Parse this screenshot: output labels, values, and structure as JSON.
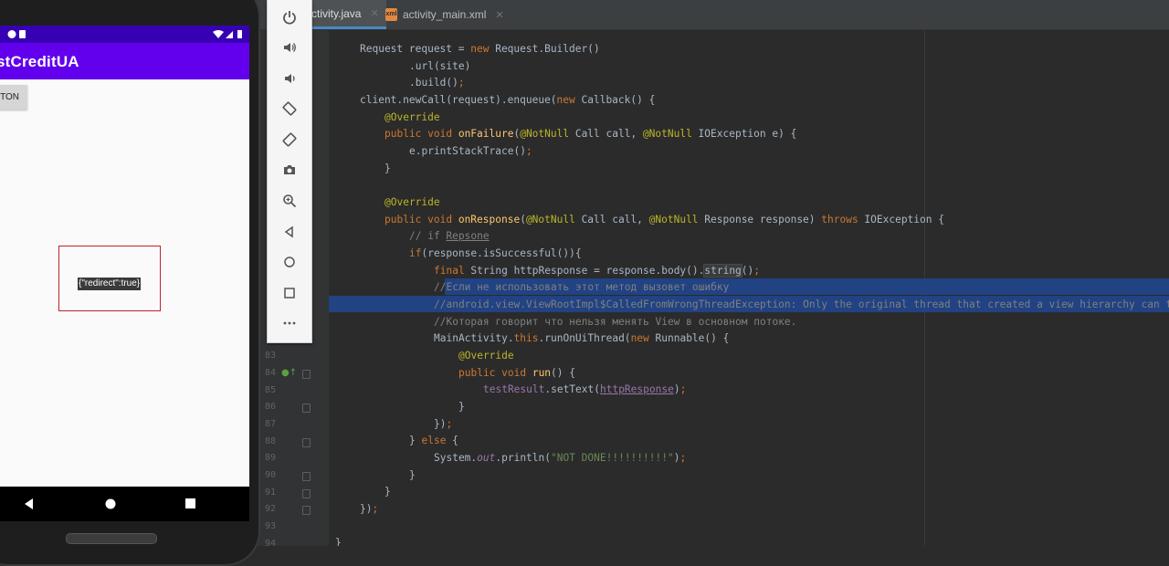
{
  "ide": {
    "tabs": [
      {
        "label": "ctivity.java",
        "active": true
      },
      {
        "label": "activity_main.xml",
        "active": false
      }
    ],
    "tab_close_glyph": "✕",
    "xml_icon_text": "xml",
    "line_numbers": [
      "83",
      "84",
      "85",
      "86",
      "87",
      "88",
      "89",
      "90",
      "91",
      "92",
      "93",
      "94"
    ],
    "code": {
      "l1": {
        "a": "Request request = ",
        "b": "new",
        "c": " Request.Builder()"
      },
      "l2": ".url(site)",
      "l3": {
        "a": ".build()",
        "b": ";"
      },
      "l4": {
        "a": "client.newCall(request).enqueue(",
        "b": "new",
        "c": " Callback() {"
      },
      "l5": "@Override",
      "l6": {
        "a": "public void ",
        "b": "onFailure",
        "c": "(",
        "d": "@NotNull",
        "e": " Call call, ",
        "f": "@NotNull",
        "g": " IOException e) {"
      },
      "l7": {
        "a": "e.printStackTrace()",
        "b": ";"
      },
      "l8": "}",
      "l10": "@Override",
      "l11": {
        "a": "public void ",
        "b": "onResponse",
        "c": "(",
        "d": "@NotNull",
        "e": " Call call, ",
        "f": "@NotNull",
        "g": " Response response) ",
        "h": "throws",
        "i": " IOException {"
      },
      "l12": {
        "a": "// if ",
        "b": "Repsone"
      },
      "l13": {
        "a": "if",
        "b": "(response.isSuccessful()){"
      },
      "l14": {
        "a": "final",
        "b": " String httpResponse = response.body().",
        "c": "string",
        "d": "()",
        "e": ";"
      },
      "l15": "//Если не использовать этот метод вызовет ошибку",
      "l16": "//android.view.ViewRootImpl$CalledFromWrongThreadException: Only the original thread that created a view hierarchy can t",
      "l17": "//Которая говорит что нельзя менять View в основном потоке.",
      "l18": {
        "a": "MainActivity.",
        "b": "this",
        "c": ".runOnUiThread(",
        "d": "new",
        "e": " Runnable() {"
      },
      "l19": "@Override",
      "l20": {
        "a": "public void ",
        "b": "run",
        "c": "() {"
      },
      "l21": {
        "a": "testResult",
        "b": ".setText(",
        "c": "httpResponse",
        "d": ")",
        "e": ";"
      },
      "l22": "}",
      "l23": {
        "a": "})",
        "b": ";"
      },
      "l24": {
        "a": "} ",
        "b": "else",
        "c": " {"
      },
      "l25": {
        "a": "System.",
        "b": "out",
        "c": ".println(",
        "d": "\"NOT DONE!!!!!!!!!!\"",
        "e": ")",
        "f": ";"
      },
      "l26": "}",
      "l27": "}",
      "l28": {
        "a": "})",
        "b": ";"
      },
      "l30": "}"
    }
  },
  "emulator_toolbar": {
    "buttons": [
      "power-icon",
      "volume-up-icon",
      "volume-down-icon",
      "rotate-left-icon",
      "rotate-right-icon",
      "camera-icon",
      "zoom-icon",
      "back-icon",
      "home-icon",
      "overview-icon",
      "more-icon"
    ]
  },
  "phone": {
    "app_title": "stCreditUA",
    "button_label": "TON",
    "result_text": "{\"redirect\":true}"
  },
  "colors": {
    "status_bar": "#3700b3",
    "app_bar": "#6200ee",
    "selection": "#214283",
    "editor_bg": "#2b2b2b"
  }
}
